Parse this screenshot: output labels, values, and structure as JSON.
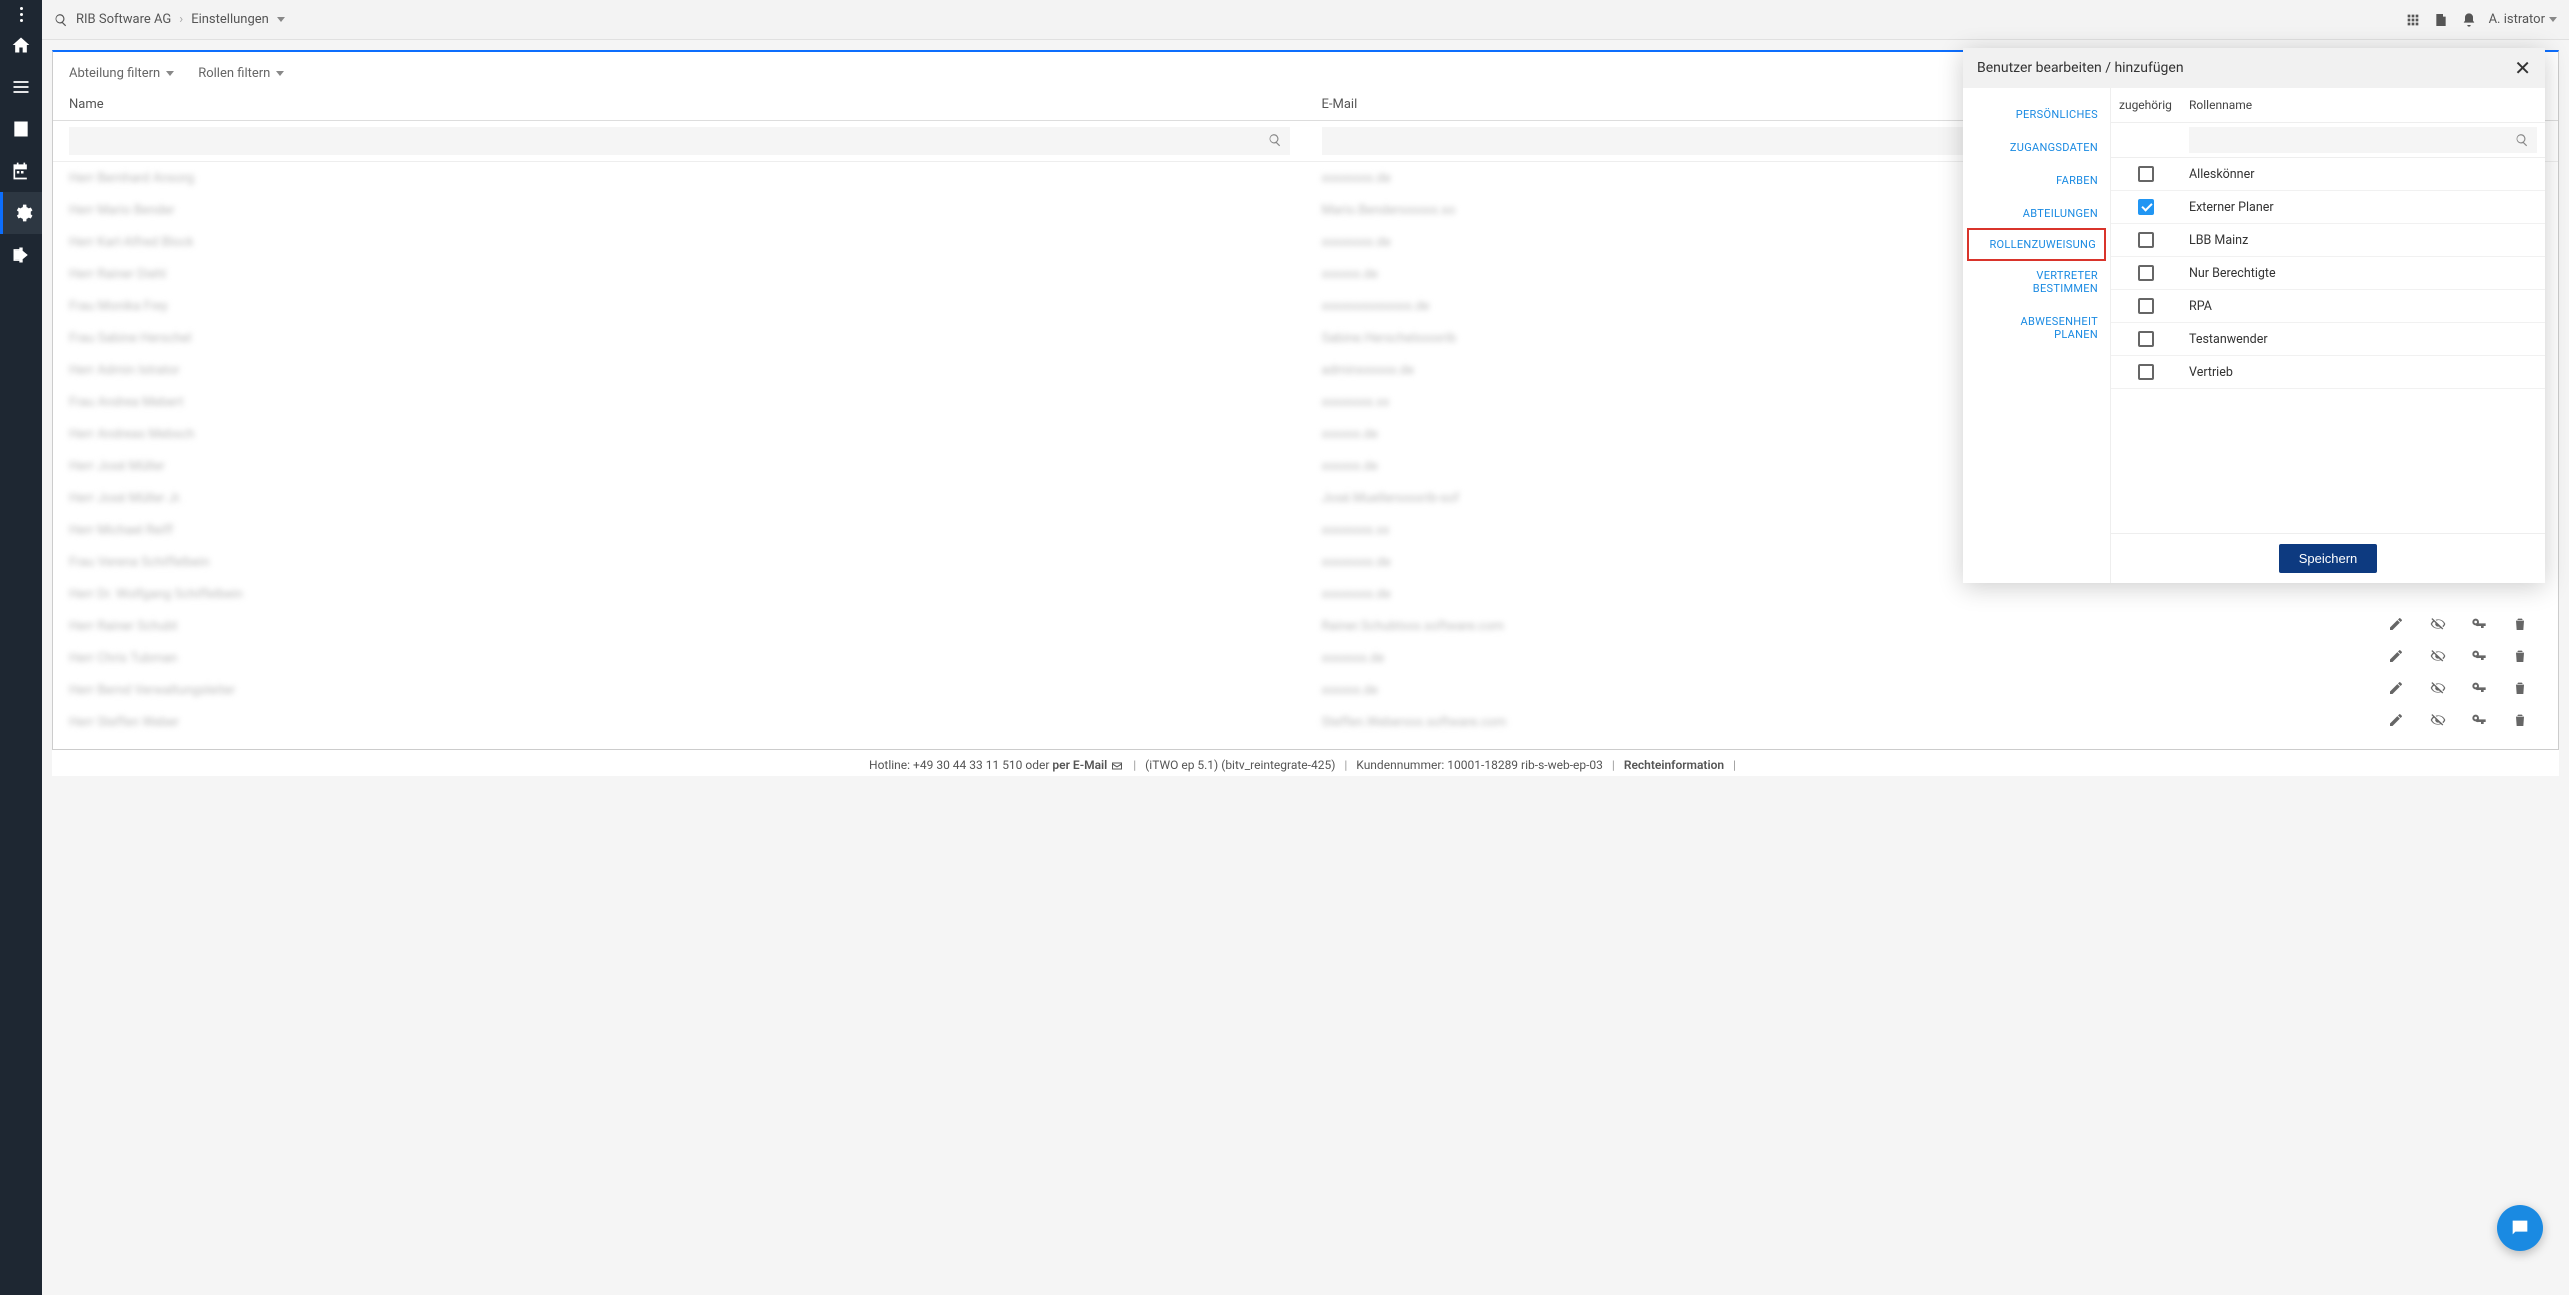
{
  "breadcrumb": {
    "company": "RIB Software AG",
    "page": "Einstellungen"
  },
  "user_label": "A. istrator",
  "filters": {
    "dept": "Abteilung filtern",
    "roles": "Rollen filtern"
  },
  "table": {
    "headers": {
      "name": "Name",
      "email": "E-Mail"
    }
  },
  "blurred_rows": [
    {
      "name": "Herr Bernhard Ansorg",
      "email": "xxxxxxxx.de"
    },
    {
      "name": "Herr Mario Bender",
      "email": "Mario.Benderxxxxxx.so"
    },
    {
      "name": "Herr Karl-Alfred Block",
      "email": "xxxxxxxx.de"
    },
    {
      "name": "Herr Rainer Diehl",
      "email": "xxxxxx.de"
    },
    {
      "name": "Frau Monika Frey",
      "email": "xxxxxxxxxxxxxx.de"
    },
    {
      "name": "Frau Sabine Herschel",
      "email": "Sabine.Herschelxxxxrib"
    },
    {
      "name": "Herr Admin Istrator",
      "email": "adminxxxxxx.de"
    },
    {
      "name": "Frau Andrea Mebert",
      "email": "xxxxxxxx.xx"
    },
    {
      "name": "Herr Andreas Mebsch",
      "email": "xxxxxx.de"
    },
    {
      "name": "Herr José Müller",
      "email": "xxxxxx.de"
    },
    {
      "name": "Herr José Müller Jr.",
      "email": "José.Muellerxxxxrib-sof"
    },
    {
      "name": "Herr Michael Reiff",
      "email": "xxxxxxxx.xx"
    },
    {
      "name": "Frau Verena Schiffelbein",
      "email": "xxxxxxxx.de"
    },
    {
      "name": "Herr Dr. Wolfgang Schiffelbein",
      "email": "xxxxxxxx.de"
    },
    {
      "name": "Herr Rainer Schubt",
      "email": "Rainer.Schubtxxx.software.com"
    },
    {
      "name": "Herr Chris Tubman",
      "email": "xxxxxxx.de"
    },
    {
      "name": "Herr Bernd Verwaltungsleiter",
      "email": "xxxxxx.de"
    },
    {
      "name": "Herr Steffen Weber",
      "email": "Steffen.Weberxxx.software.com"
    }
  ],
  "modal": {
    "title": "Benutzer bearbeiten / hinzufügen",
    "nav": {
      "personal": "PERSÖNLICHES",
      "access": "ZUGANGSDATEN",
      "colors": "FARBEN",
      "depts": "ABTEILUNGEN",
      "roles": "ROLLENZUWEISUNG",
      "deputy": "VERTRETER BESTIMMEN",
      "absence": "ABWESENHEIT PLANEN"
    },
    "columns": {
      "assoc": "zugehörig",
      "name": "Rollenname"
    },
    "roles": [
      {
        "name": "Alleskönner",
        "checked": false
      },
      {
        "name": "Externer Planer",
        "checked": true
      },
      {
        "name": "LBB Mainz",
        "checked": false
      },
      {
        "name": "Nur Berechtigte",
        "checked": false
      },
      {
        "name": "RPA",
        "checked": false
      },
      {
        "name": "Testanwender",
        "checked": false
      },
      {
        "name": "Vertrieb",
        "checked": false
      }
    ],
    "save": "Speichern"
  },
  "footer": {
    "hotline_prefix": "Hotline: +49 30 44 33 11 510 oder ",
    "hotline_email": "per E-Mail",
    "version": "(iTWO ep 5.1) (bitv_reintegrate-425)",
    "customer": "Kundennummer: 10001-18289 rib-s-web-ep-03",
    "legal": "Rechteinformation"
  }
}
